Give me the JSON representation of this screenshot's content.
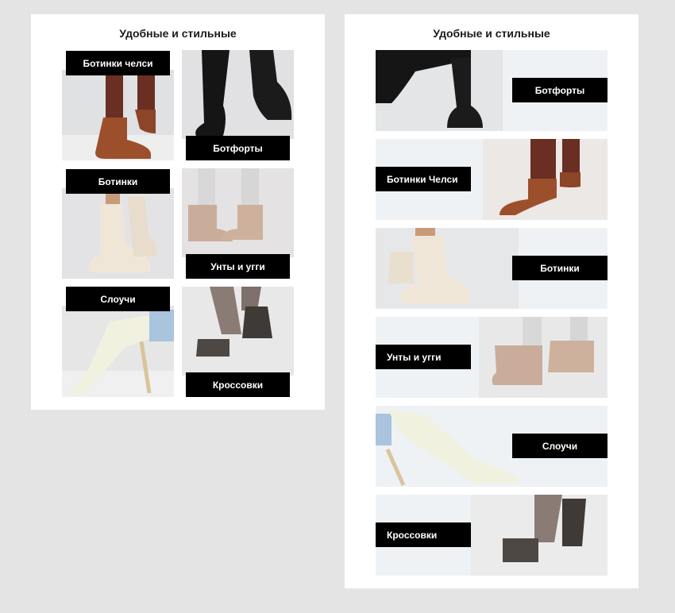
{
  "grid_card": {
    "title": "Удобные и стильные",
    "tiles": [
      {
        "label": "Ботинки челси",
        "product": "chelsea-boot"
      },
      {
        "label": "Ботфорты",
        "product": "over-knee-boot"
      },
      {
        "label": "Ботинки",
        "product": "lace-up-boot"
      },
      {
        "label": "Унты и угги",
        "product": "ugg-boot"
      },
      {
        "label": "Слоучи",
        "product": "slouch-boot"
      },
      {
        "label": "Кроссовки",
        "product": "sneaker"
      }
    ]
  },
  "list_card": {
    "title": "Удобные и стильные",
    "banners": [
      {
        "label": "Ботфорты",
        "product": "over-knee-boot"
      },
      {
        "label": "Ботинки Челси",
        "product": "chelsea-boot"
      },
      {
        "label": "Ботинки",
        "product": "lace-up-boot"
      },
      {
        "label": "Унты и угги",
        "product": "ugg-boot"
      },
      {
        "label": "Слоучи",
        "product": "slouch-boot"
      },
      {
        "label": "Кроссовки",
        "product": "sneaker"
      }
    ]
  },
  "colors": {
    "page_background": "#e4e4e4",
    "card_background": "#ffffff",
    "label_background": "#000000",
    "label_text": "#ffffff"
  }
}
